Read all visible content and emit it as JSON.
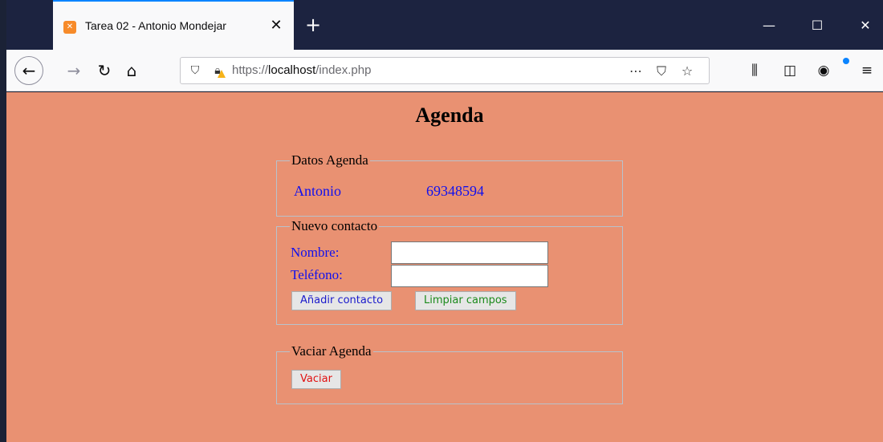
{
  "browser": {
    "tab_title": "Tarea 02 - Antonio Mondejar",
    "tab_favicon": "xampp-icon",
    "url_prefix": "https://",
    "url_host": "localhost",
    "url_path": "/index.php"
  },
  "page": {
    "title": "Agenda",
    "background_color": "#e99172",
    "datos_agenda": {
      "legend": "Datos Agenda",
      "contact_name": "Antonio",
      "contact_phone": "69348594"
    },
    "nuevo_contacto": {
      "legend": "Nuevo contacto",
      "nombre_label": "Nombre:",
      "telefono_label": "Teléfono:",
      "nombre_value": "",
      "telefono_value": "",
      "add_button": "Añadir contacto",
      "clear_button": "Limpiar campos"
    },
    "vaciar_agenda": {
      "legend": "Vaciar Agenda",
      "empty_button": "Vaciar"
    }
  },
  "colors": {
    "label_blue": "#1010ee",
    "add_button_text": "#1a1acc",
    "clear_button_text": "#1b8a1b",
    "empty_button_text": "#e01010",
    "titlebar": "#1c2340"
  }
}
